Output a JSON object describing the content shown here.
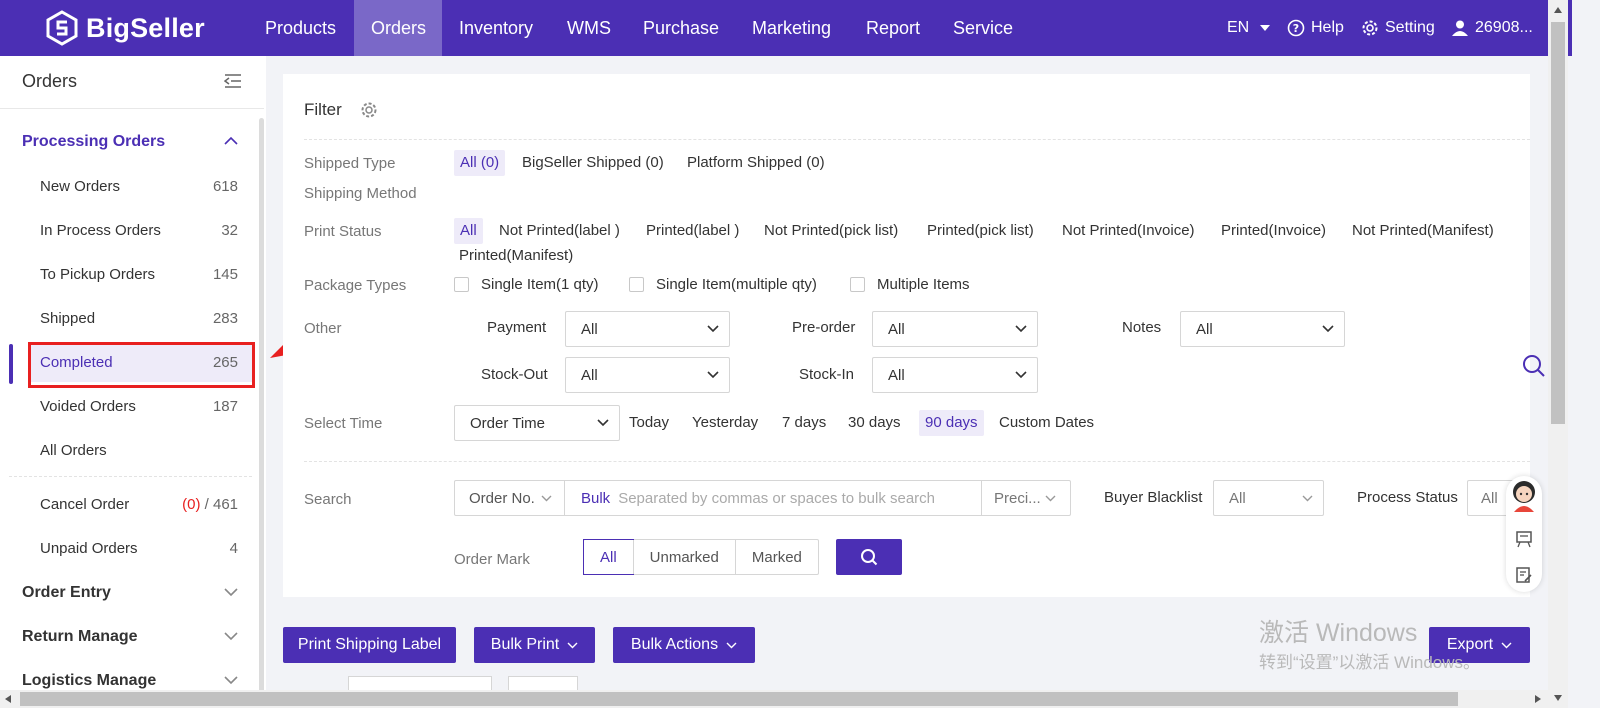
{
  "topnav": {
    "logo_text": "BigSeller",
    "items": [
      "Products",
      "Orders",
      "Inventory",
      "WMS",
      "Purchase",
      "Marketing",
      "Report",
      "Service"
    ],
    "active_index": 1,
    "lang": "EN",
    "help": "Help",
    "setting": "Setting",
    "user": "26908..."
  },
  "sidebar": {
    "title": "Orders",
    "processing": "Processing Orders",
    "items": [
      {
        "label": "New Orders",
        "count": "618"
      },
      {
        "label": "In Process Orders",
        "count": "32"
      },
      {
        "label": "To Pickup Orders",
        "count": "145"
      },
      {
        "label": "Shipped",
        "count": "283"
      },
      {
        "label": "Completed",
        "count": "265"
      },
      {
        "label": "Voided Orders",
        "count": "187"
      },
      {
        "label": "All Orders",
        "count": ""
      }
    ],
    "cancel_order": {
      "label": "Cancel Order",
      "red": "(0)",
      "rest": " / 461"
    },
    "unpaid_orders": {
      "label": "Unpaid Orders",
      "count": "4"
    },
    "sections": [
      "Order Entry",
      "Return Manage",
      "Logistics Manage"
    ]
  },
  "filter": {
    "title": "Filter",
    "shipped_type_label": "Shipped Type",
    "shipped_types": [
      "All (0)",
      "BigSeller Shipped (0)",
      "Platform Shipped (0)"
    ],
    "shipping_method_label": "Shipping Method",
    "print_status_label": "Print Status",
    "print_statuses": [
      "All",
      "Not Printed(label )",
      "Printed(label )",
      "Not Printed(pick list)",
      "Printed(pick list)",
      "Not Printed(Invoice)",
      "Printed(Invoice)",
      "Not Printed(Manifest)",
      "Printed(Manifest)"
    ],
    "package_types_label": "Package Types",
    "package_types": [
      "Single Item(1 qty)",
      "Single Item(multiple qty)",
      "Multiple Items"
    ],
    "other_label": "Other",
    "payment_label": "Payment",
    "payment_value": "All",
    "preorder_label": "Pre-order",
    "preorder_value": "All",
    "notes_label": "Notes",
    "notes_value": "All",
    "stockout_label": "Stock-Out",
    "stockout_value": "All",
    "stockin_label": "Stock-In",
    "stockin_value": "All",
    "select_time_label": "Select Time",
    "time_field": "Order Time",
    "time_options": [
      "Today",
      "Yesterday",
      "7 days",
      "30 days",
      "90 days",
      "Custom Dates"
    ],
    "search_label": "Search",
    "search_field": "Order No.",
    "bulk": "Bulk",
    "search_placeholder": "Separated by commas or spaces to bulk search",
    "precise": "Preci...",
    "buyer_blacklist_label": "Buyer Blacklist",
    "buyer_blacklist_value": "All",
    "process_status_label": "Process Status",
    "process_status_value": "All",
    "order_mark_label": "Order Mark",
    "order_marks": [
      "All",
      "Unmarked",
      "Marked"
    ]
  },
  "actions": {
    "print_shipping_label": "Print Shipping Label",
    "bulk_print": "Bulk Print",
    "bulk_actions": "Bulk Actions",
    "export": "Export"
  },
  "watermark": {
    "line1": "激活 Windows",
    "line2": "转到“设置”以激活 Windows。"
  },
  "colors": {
    "brand": "#4b2fb4",
    "highlight": "#e82020"
  }
}
